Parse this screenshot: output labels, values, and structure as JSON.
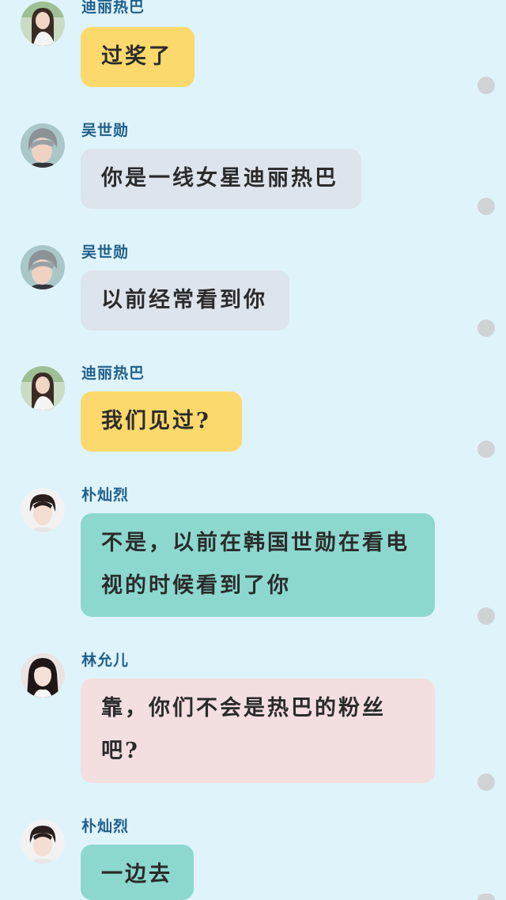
{
  "messages": [
    {
      "sender": "迪丽热巴",
      "text": "过奖了",
      "bubble_color": "#fbd96c",
      "avatar": "dilireba-avatar"
    },
    {
      "sender": "吴世勋",
      "text": "你是一线女星迪丽热巴",
      "bubble_color": "#dde4ec",
      "avatar": "wushixun-avatar"
    },
    {
      "sender": "吴世勋",
      "text": "以前经常看到你",
      "bubble_color": "#dde4ec",
      "avatar": "wushixun-avatar"
    },
    {
      "sender": "迪丽热巴",
      "text": "我们见过?",
      "bubble_color": "#fbd96c",
      "avatar": "dilireba-avatar"
    },
    {
      "sender": "朴灿烈",
      "text": "不是，以前在韩国世勋在看电视的时候看到了你",
      "bubble_color": "#8cd8cf",
      "avatar": "puchanlie-avatar"
    },
    {
      "sender": "林允儿",
      "text": "靠，你们不会是热巴的粉丝吧?",
      "bubble_color": "#f3dfdf",
      "avatar": "linyuner-avatar"
    },
    {
      "sender": "朴灿烈",
      "text": "一边去",
      "bubble_color": "#8cd8cf",
      "avatar": "puchanlie-avatar"
    }
  ],
  "colors": {
    "background": "#dff3fb",
    "name_text": "#1f5f8b",
    "message_text": "#2b2b2b",
    "status_dot": "#cfd3d6"
  }
}
